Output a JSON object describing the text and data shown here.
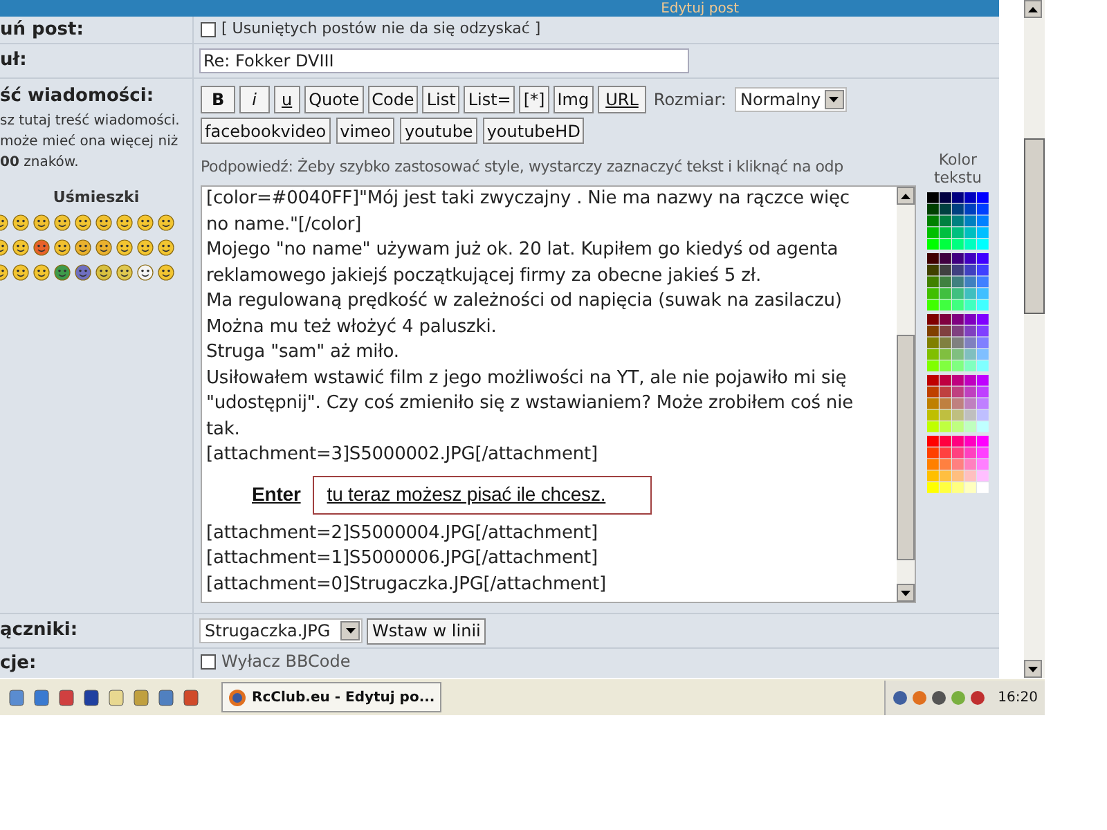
{
  "header": {
    "title": "Edytuj post"
  },
  "delete_row": {
    "label": "uń post:",
    "checkbox": {
      "checked": false,
      "label": "[ Usuniętych postów nie da się odzyskać ]"
    }
  },
  "title_row": {
    "label": "uł:",
    "value": "Re: Fokker DVIII"
  },
  "message_row": {
    "label": "ść wiadomości:",
    "help": "sz tutaj treść wiadomości. może mieć ona więcej niż **00** znaków.",
    "smileys_title": "Uśmieszki",
    "toolbar": [
      {
        "label": "B",
        "kind": "bold"
      },
      {
        "label": "i",
        "kind": "italic"
      },
      {
        "label": "u",
        "kind": "underline"
      },
      {
        "label": "Quote",
        "kind": "plain"
      },
      {
        "label": "Code",
        "kind": "plain"
      },
      {
        "label": "List",
        "kind": "plain"
      },
      {
        "label": "List=",
        "kind": "plain"
      },
      {
        "label": "[*]",
        "kind": "plain"
      },
      {
        "label": "Img",
        "kind": "plain"
      },
      {
        "label": "URL",
        "kind": "underline"
      }
    ],
    "size_label": "Rozmiar:",
    "size_value": "Normalny",
    "media_buttons": [
      "facebookvideo",
      "vimeo",
      "youtube",
      "youtubeHD"
    ],
    "hint": "Podpowiedź: Żeby szybko zastosować style, wystarczy zaznaczyć tekst i kliknąć na odp",
    "color_label": "Kolor tekstu",
    "editor_lines": [
      {
        "kind": "text",
        "text": "[color=#0040FF]\"Mój jest taki zwyczajny . Nie ma nazwy na rączce więc"
      },
      {
        "kind": "text",
        "text": "no name.\"[/color]"
      },
      {
        "kind": "text",
        "text": "Mojego \"no name\" używam już ok. 20 lat. Kupiłem go kiedyś od agenta"
      },
      {
        "kind": "text",
        "text": "reklamowego jakiejś początkującej firmy za obecne jakieś 5 zł."
      },
      {
        "kind": "text",
        "text": "Ma regulowaną prędkość w zależności od napięcia (suwak na zasilaczu)"
      },
      {
        "kind": "text",
        "text": "Można mu też włożyć 4 paluszki."
      },
      {
        "kind": "text",
        "text": "Struga \"sam\" aż miło."
      },
      {
        "kind": "text",
        "text": "Usiłowałem wstawić film z jego możliwości na YT, ale nie pojawiło mi się"
      },
      {
        "kind": "text",
        "text": "\"udostępnij\". Czy coś zmieniło się z wstawianiem? Może zrobiłem coś nie"
      },
      {
        "kind": "text",
        "text": "tak."
      },
      {
        "kind": "text",
        "text": "[attachment=3]S5000002.JPG[/attachment]"
      },
      {
        "kind": "annotation",
        "key": "Enter",
        "note": "tu teraz możesz pisać ile chcesz."
      },
      {
        "kind": "text",
        "text": "[attachment=2]S5000004.JPG[/attachment]"
      },
      {
        "kind": "text",
        "text": "[attachment=1]S5000006.JPG[/attachment]"
      },
      {
        "kind": "text",
        "text": "[attachment=0]Strugaczka.JPG[/attachment]"
      }
    ]
  },
  "attachments_row": {
    "label": "ączniki:",
    "select": "Strugaczka.JPG",
    "button": "Wstaw w linii"
  },
  "options_row": {
    "label": "cje:",
    "checkbox": {
      "checked": false,
      "label": "Wyłacz BBCode"
    }
  },
  "taskbar": {
    "task": "RcClub.eu - Edytuj po...",
    "clock": "16:20"
  }
}
